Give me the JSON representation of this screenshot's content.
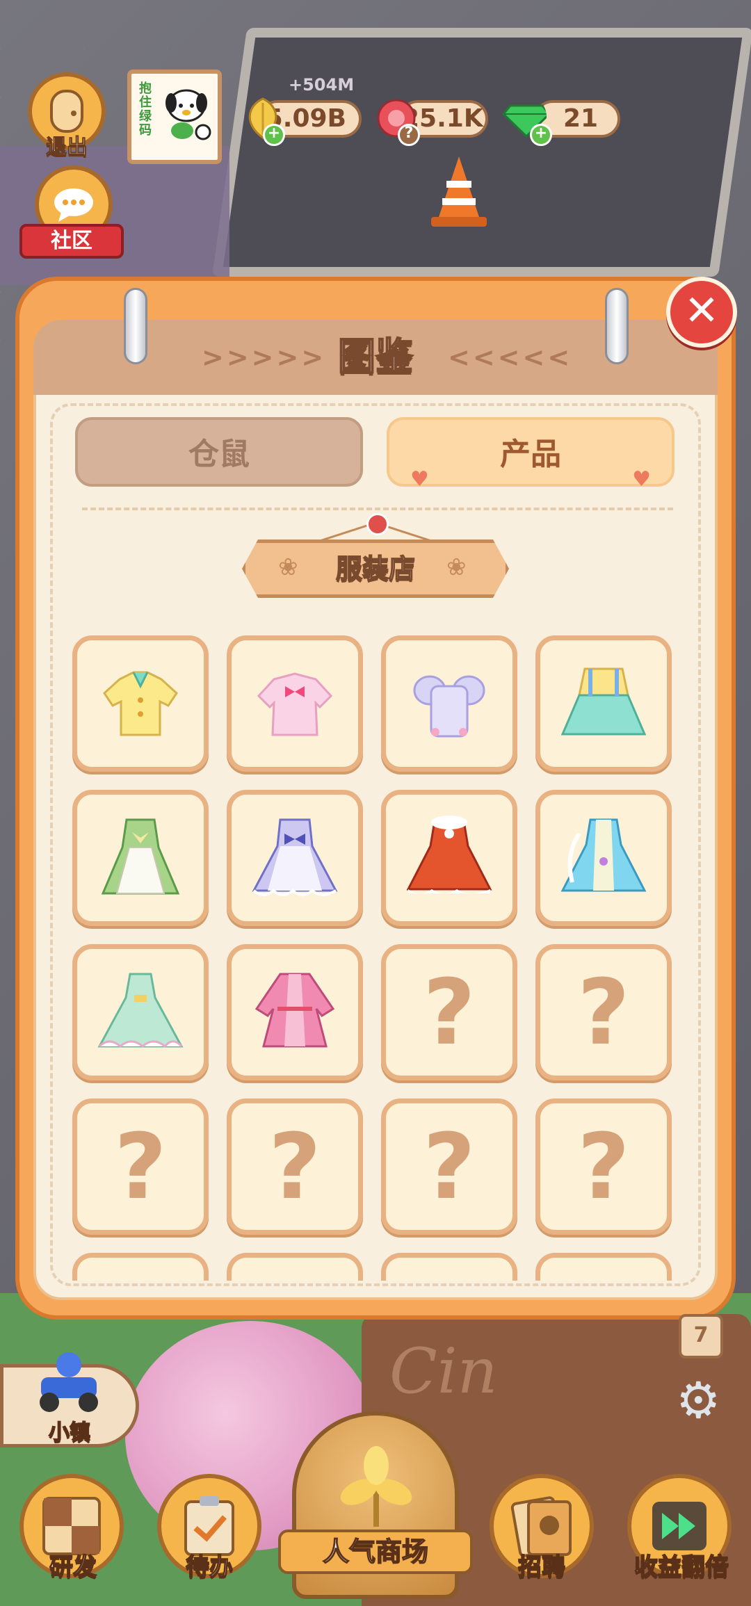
{
  "hud": {
    "exit_label": "退出",
    "community_label": "社区",
    "poster_text": "抱住绿码",
    "gain_text": "+504M",
    "resources": [
      {
        "name": "gold",
        "value": "5.09B",
        "color": "#f3c94a"
      },
      {
        "name": "gem-red",
        "value": "25.1K",
        "color": "#e8505a"
      },
      {
        "name": "diamond",
        "value": "21",
        "color": "#3cc85a"
      }
    ]
  },
  "panel": {
    "title": "图鉴",
    "arrows_left": ">>>>>",
    "arrows_right": "<<<<<",
    "close_symbol": "✕",
    "tabs": [
      {
        "label": "仓鼠",
        "active": false
      },
      {
        "label": "产品",
        "active": true
      }
    ],
    "category": "服装店",
    "items": [
      {
        "name": "yellow-collar-shirt",
        "unlocked": true
      },
      {
        "name": "pink-bow-blouse",
        "unlocked": true
      },
      {
        "name": "lavender-puff-top",
        "unlocked": true
      },
      {
        "name": "suspender-skirt",
        "unlocked": true
      },
      {
        "name": "green-pinafore-dress",
        "unlocked": true
      },
      {
        "name": "lavender-lolita-dress",
        "unlocked": true
      },
      {
        "name": "red-fur-dress",
        "unlocked": true
      },
      {
        "name": "blue-fantasy-dress",
        "unlocked": true
      },
      {
        "name": "mint-ruffle-dress",
        "unlocked": true
      },
      {
        "name": "pink-hanfu-dress",
        "unlocked": true
      },
      {
        "name": "unknown",
        "unlocked": false,
        "symbol": "?"
      },
      {
        "name": "unknown",
        "unlocked": false,
        "symbol": "?"
      },
      {
        "name": "unknown",
        "unlocked": false,
        "symbol": "?"
      },
      {
        "name": "unknown",
        "unlocked": false,
        "symbol": "?"
      },
      {
        "name": "unknown",
        "unlocked": false,
        "symbol": "?"
      },
      {
        "name": "unknown",
        "unlocked": false,
        "symbol": "?"
      }
    ]
  },
  "bottom": {
    "town_label": "小镇",
    "research_label": "研发",
    "todo_label": "待办",
    "mall_label": "人气商场",
    "recruit_label": "招聘",
    "double_label": "收益翻倍",
    "calendar_day": "7",
    "shop_sign": "Cin"
  }
}
